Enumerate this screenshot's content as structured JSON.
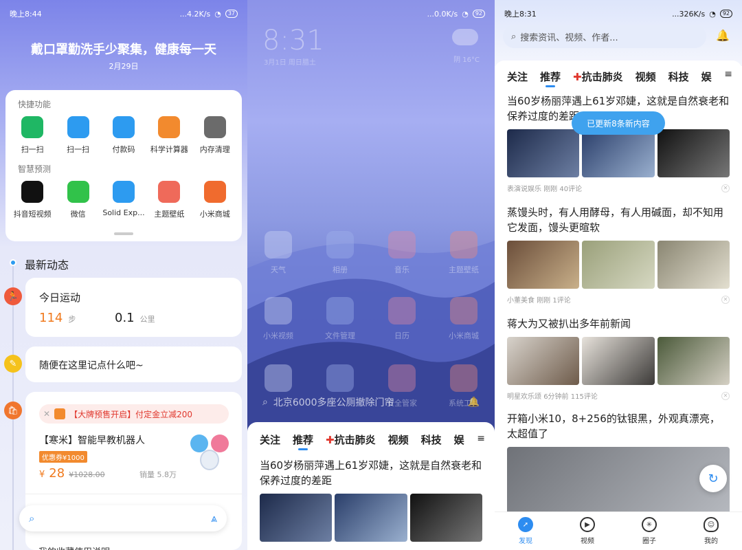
{
  "panel1": {
    "status": {
      "time": "晚上8:44",
      "speed": "...4.2K/s",
      "battery": "37"
    },
    "slogan": "戴口罩勤洗手少聚集，健康每一天",
    "date": "2月29日",
    "quick_label": "快捷功能",
    "quick_apps": [
      {
        "label": "扫一扫",
        "color": "#1fb764",
        "icon": "scan-icon"
      },
      {
        "label": "扫一扫",
        "color": "#2d9bf0",
        "icon": "scan-icon"
      },
      {
        "label": "付款码",
        "color": "#2d9bf0",
        "icon": "barcode-icon"
      },
      {
        "label": "科学计算器",
        "color": "#f28a2e",
        "icon": "calculator-icon"
      },
      {
        "label": "内存清理",
        "color": "#6b6b6b",
        "icon": "clean-icon"
      }
    ],
    "smart_label": "智慧预测",
    "smart_apps": [
      {
        "label": "抖音短视频",
        "color": "#111111",
        "icon": "tiktok-icon"
      },
      {
        "label": "微信",
        "color": "#31c24a",
        "icon": "wechat-icon"
      },
      {
        "label": "Solid Exp...",
        "color": "#2d9bf0",
        "icon": "folder-icon"
      },
      {
        "label": "主题壁纸",
        "color": "#ef6a5a",
        "icon": "theme-icon"
      },
      {
        "label": "小米商城",
        "color": "#f06b2e",
        "icon": "mi-icon"
      }
    ],
    "feed_title": "最新动态",
    "sport": {
      "title": "今日运动",
      "steps": "114",
      "steps_unit": "步",
      "km": "0.1",
      "km_unit": "公里"
    },
    "note": "随便在这里记点什么吧~",
    "promo": {
      "banner": "【大牌预售开启】付定金立减200",
      "product": "【寒米】智能早教机器人",
      "coupon": "优惠券¥1000",
      "price_symbol": "¥",
      "price": "28",
      "old_price": "¥1028.00",
      "sales": "销量 5.8万"
    },
    "partial_text": "我的收藏使用说明"
  },
  "panel2": {
    "status": {
      "speed": "...0.0K/s",
      "battery": "92"
    },
    "clock": "8:31",
    "clock_date": "3月1日 周日腊土",
    "weather": "阴 16°C",
    "ghost_row1": [
      "天气",
      "相册",
      "音乐",
      "主题壁纸"
    ],
    "ghost_row2": [
      "小米视频",
      "文件管理",
      "日历",
      "小米商城"
    ],
    "ghost_row3": [
      "",
      "",
      "安全管家",
      "系统工具"
    ],
    "search_text": "北京6000多座公厕撤除门帘",
    "tabs": [
      "关注",
      "推荐",
      "抗击肺炎",
      "视频",
      "科技",
      "娱"
    ],
    "headline": "当60岁杨丽萍遇上61岁邓婕，这就是自然衰老和保养过度的差距"
  },
  "panel3": {
    "status": {
      "time": "晚上8:31",
      "speed": "...326K/s",
      "battery": "92"
    },
    "search_placeholder": "搜索资讯、视频、作者...",
    "tabs": [
      "关注",
      "推荐",
      "抗击肺炎",
      "视频",
      "科技",
      "娱"
    ],
    "updated": "已更新8条新内容",
    "news": [
      {
        "title": "当60岁杨丽萍遇上61岁邓婕，这就是自然衰老和保养过度的差距",
        "source": "表演说娱乐",
        "time": "刚刚",
        "comments": "40评论"
      },
      {
        "title": "蒸馒头时，有人用酵母，有人用碱面，却不知用它发面，馒头更暄软",
        "source": "小董美食",
        "time": "刚刚",
        "comments": "1评论"
      },
      {
        "title": "蒋大为又被扒出多年前新闻",
        "source": "明星欢乐颂",
        "time": "6分钟前",
        "comments": "115评论"
      },
      {
        "title": "开箱小米10，8+256的钛银黑，外观真漂亮，太超值了",
        "source": "",
        "time": "",
        "comments": ""
      }
    ],
    "nav": [
      "发现",
      "视频",
      "圈子",
      "我的"
    ]
  }
}
